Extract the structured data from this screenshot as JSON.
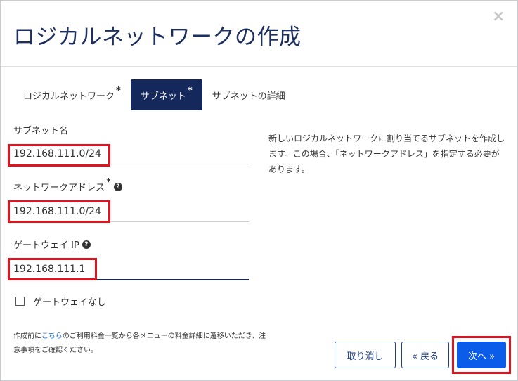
{
  "dialog": {
    "title": "ロジカルネットワークの作成",
    "close_glyph": "×"
  },
  "tabs": [
    {
      "label": "ロジカルネットワーク",
      "required_mark": "*"
    },
    {
      "label": "サブネット",
      "required_mark": "*"
    },
    {
      "label": "サブネットの詳細",
      "required_mark": ""
    }
  ],
  "form": {
    "subnet_name": {
      "label": "サブネット名",
      "value": "192.168.111.0/24"
    },
    "network_address": {
      "label": "ネットワークアドレス",
      "required_mark": "*",
      "help_glyph": "?",
      "value": "192.168.111.0/24"
    },
    "gateway_ip": {
      "label": "ゲートウェイ IP",
      "help_glyph": "?",
      "value": "192.168.111.1"
    },
    "no_gateway": {
      "label": "ゲートウェイなし",
      "checked": false
    }
  },
  "description": "新しいロジカルネットワークに割り当てるサブネットを作成します。この場合、「ネットワークアドレス」を指定する必要があります。",
  "footnote": {
    "prefix": "作成前に",
    "link_text": "こちら",
    "suffix": "のご利用料金一覧から各メニューの料金詳細に遷移いただき、注意事項をご確認ください。"
  },
  "buttons": {
    "cancel": "取り消し",
    "back": "« 戻る",
    "next": "次へ »"
  },
  "colors": {
    "title": "#1c2f5e",
    "active_tab_bg": "#14285c",
    "primary_button": "#0b5ce8",
    "highlight_box": "#e0141e",
    "link": "#1a6ed8"
  }
}
